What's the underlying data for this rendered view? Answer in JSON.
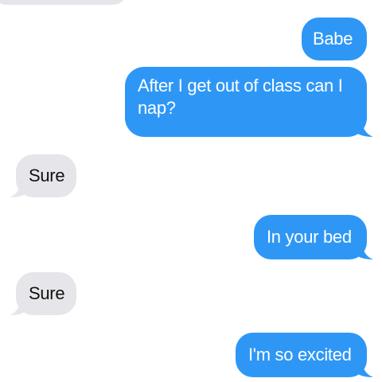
{
  "colors": {
    "sent_bubble": "#2e97f6",
    "received_bubble": "#e6e5ea",
    "sent_text": "#ffffff",
    "received_text": "#111111"
  },
  "messages": [
    {
      "direction": "received",
      "text": ""
    },
    {
      "direction": "sent",
      "text": "Babe"
    },
    {
      "direction": "sent",
      "text": "After I get out of class can I nap?"
    },
    {
      "direction": "received",
      "text": "Sure"
    },
    {
      "direction": "sent",
      "text": "In your bed"
    },
    {
      "direction": "received",
      "text": "Sure"
    },
    {
      "direction": "sent",
      "text": "I'm so excited"
    }
  ]
}
